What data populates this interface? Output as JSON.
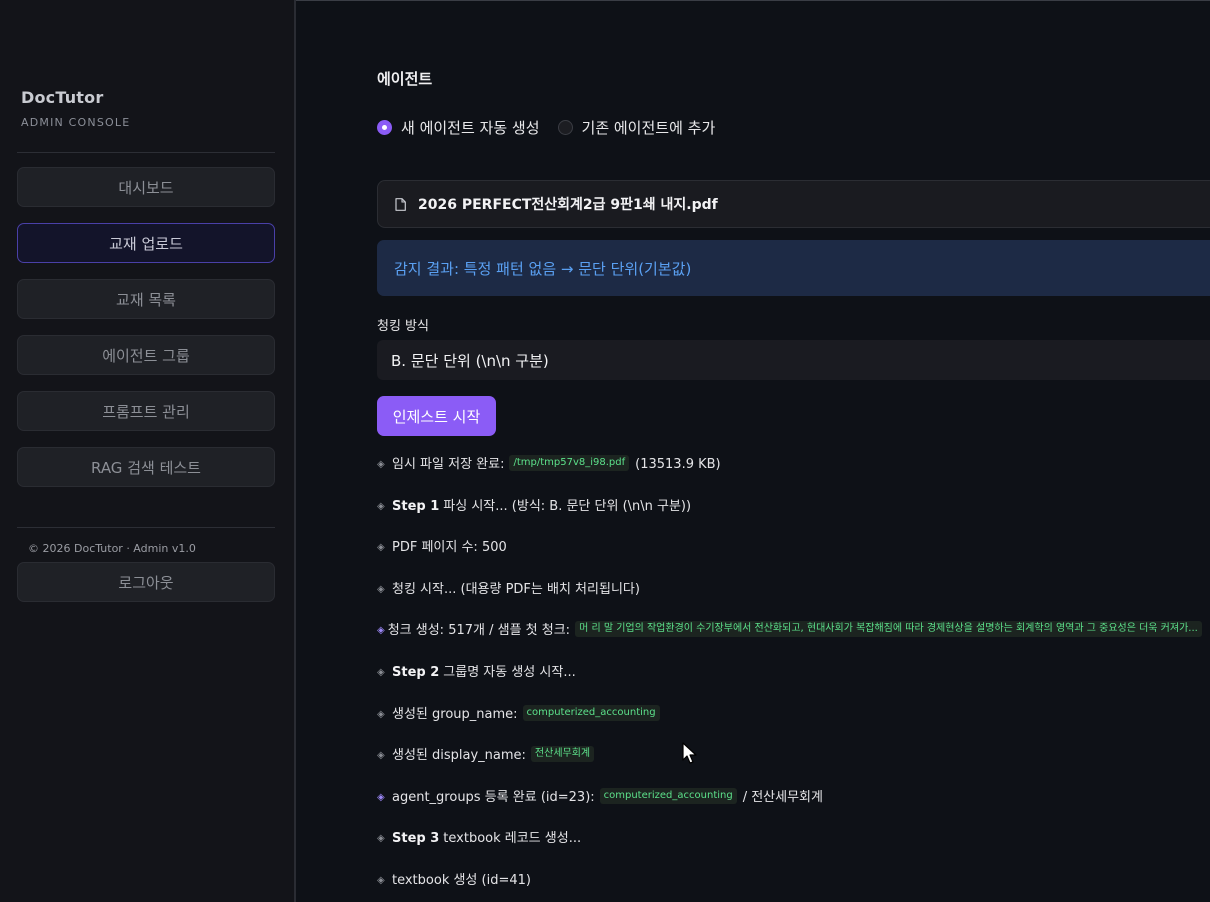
{
  "sidebar": {
    "brand_title": "DocTutor",
    "brand_subtitle": "ADMIN CONSOLE",
    "nav": [
      {
        "label": "대시보드",
        "active": false
      },
      {
        "label": "교재 업로드",
        "active": true
      },
      {
        "label": "교재 목록",
        "active": false
      },
      {
        "label": "에이전트 그룹",
        "active": false
      },
      {
        "label": "프롬프트 관리",
        "active": false
      },
      {
        "label": "RAG 검색 테스트",
        "active": false
      }
    ],
    "footer": "© 2026 DocTutor · Admin v1.0",
    "logout_label": "로그아웃"
  },
  "main": {
    "section_title": "에이전트",
    "radio_options": [
      {
        "label": "새 에이전트 자동 생성",
        "checked": true
      },
      {
        "label": "기존 에이전트에 추가",
        "checked": false
      }
    ],
    "file_name": "2026 PERFECT전산회계2급 9판1쇄 내지.pdf",
    "detect_info": "감지 결과: 특정 패턴 없음 → 문단 단위(기본값)",
    "chunk_label": "청킹 방식",
    "chunk_value": "B. 문단 단위 (\\n\\n 구분)",
    "ingest_button": "인제스트 시작",
    "log": [
      {
        "text": "임시 파일 저장 완료:",
        "code": "/tmp/tmp57v8_i98.pdf",
        "after": "(13513.9 KB)"
      },
      {
        "step": "Step 1",
        "text": "파싱 시작... (방식: B. 문단 단위 (\\n\\n 구분))"
      },
      {
        "text": "PDF 페이지 수: 500"
      },
      {
        "text": "청킹 시작... (대용량 PDF는 배치 처리됩니다)"
      },
      {
        "text": "청크 생성: 517개 / 샘플 첫 청크:",
        "code": "머 리 말 기업의 작업환경이 수기장부에서 전산화되고, 현대사회가 복잡해짐에 따라 경제현상을 설명하는 회계학의 영역과 그 중요성은 더욱 커져가...",
        "accent": true
      },
      {
        "step": "Step 2",
        "text": "그룹명 자동 생성 시작..."
      },
      {
        "text": "생성된 group_name:",
        "code": "computerized_accounting"
      },
      {
        "text": "생성된 display_name:",
        "code": "전산세무회계"
      },
      {
        "text": "agent_groups 등록 완료 (id=23):",
        "code": "computerized_accounting",
        "after": "/ 전산세무회계",
        "accent": true
      },
      {
        "step": "Step 3",
        "text": "textbook 레코드 생성..."
      },
      {
        "text": "textbook 생성 (id=41)"
      }
    ]
  },
  "colors": {
    "accent": "#8b5cf6",
    "info_bg": "#1d2a45",
    "info_text": "#5aa0f2",
    "code_text": "#5ce08a"
  }
}
